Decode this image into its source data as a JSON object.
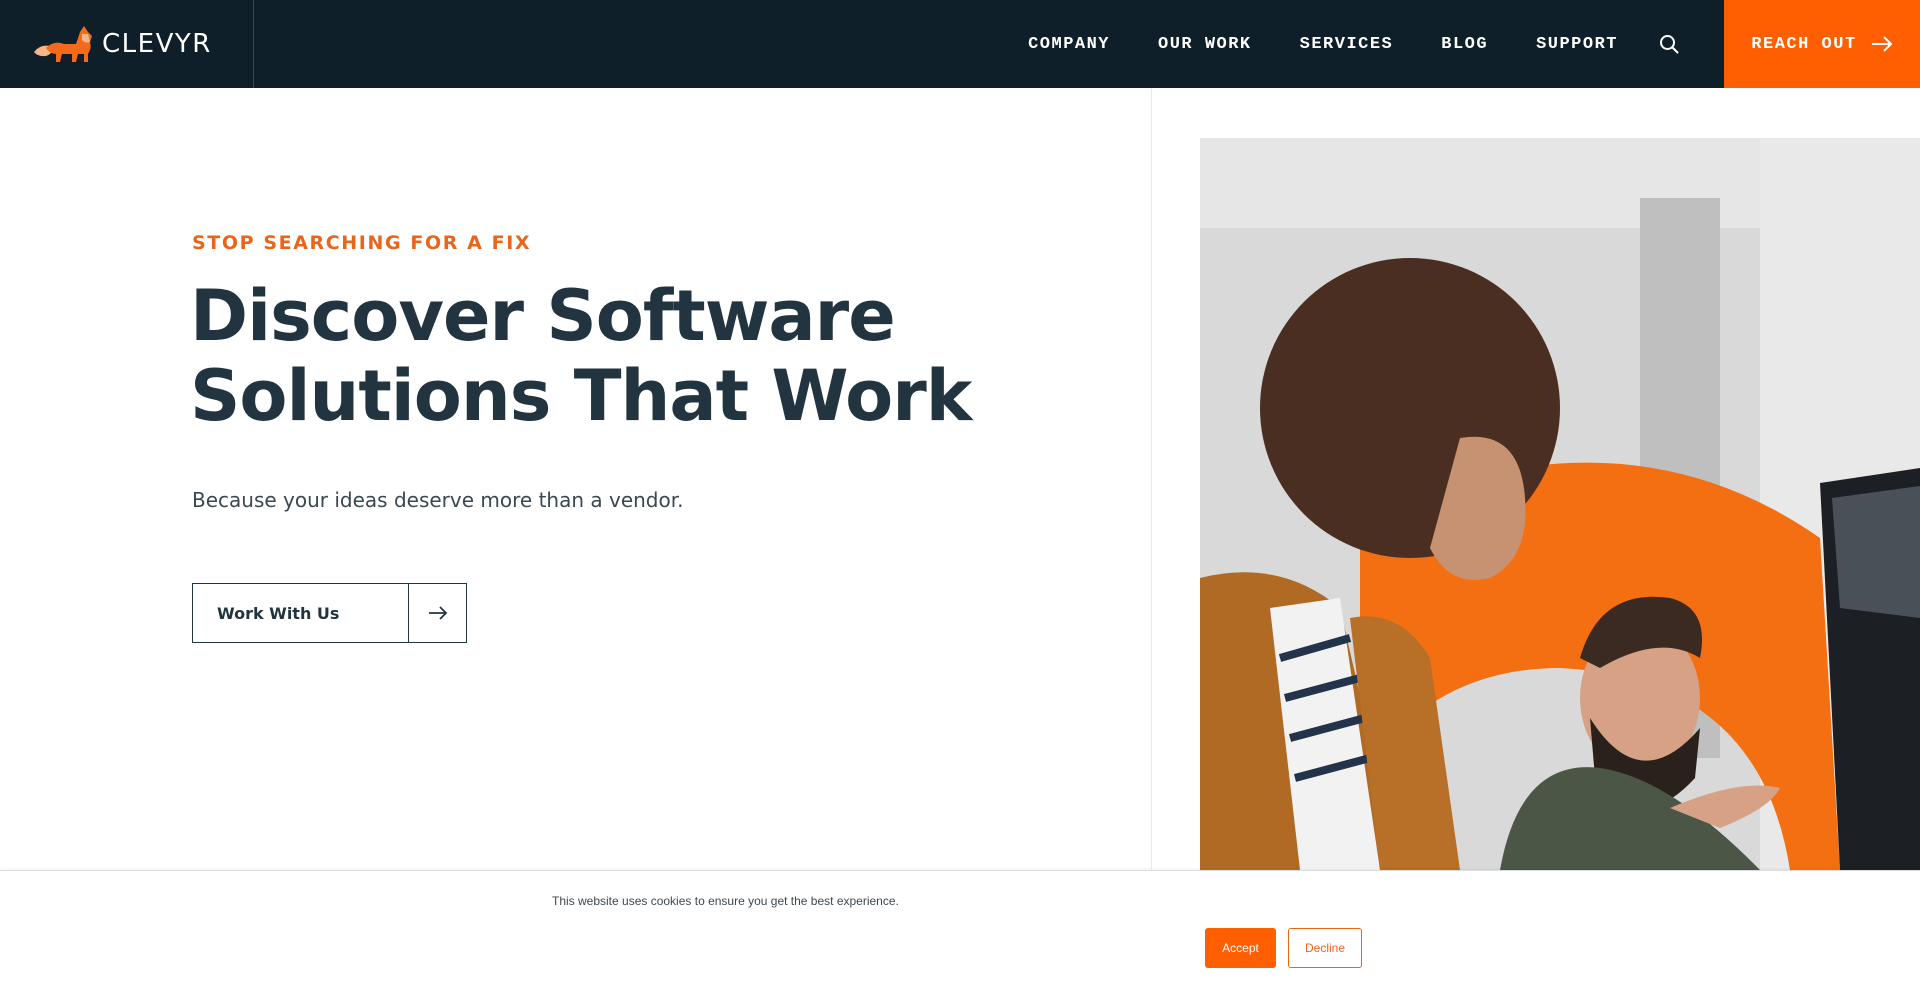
{
  "brand": {
    "name": "CLEVYR",
    "accent_color": "#ff5f00",
    "nav_bg_color": "#0e1f29",
    "heading_color": "#22343f"
  },
  "nav": {
    "items": [
      {
        "label": "COMPANY"
      },
      {
        "label": "OUR WORK"
      },
      {
        "label": "SERVICES"
      },
      {
        "label": "BLOG"
      },
      {
        "label": "SUPPORT"
      }
    ],
    "search_icon": "search-icon",
    "cta_label": "REACH OUT",
    "cta_icon": "arrow-right-icon"
  },
  "hero": {
    "eyebrow": "STOP SEARCHING FOR A FIX",
    "headline_line1": "Discover Software",
    "headline_line2": "Solutions That Work",
    "subtext": "Because your ideas deserve more than a vendor.",
    "cta_label": "Work With Us",
    "cta_icon": "arrow-right-icon",
    "image_description": "Smiling woman with curly hair and bearded man looking at a computer monitor with an orange arc behind them"
  },
  "cookie_banner": {
    "message": "This website uses cookies to ensure you get the best experience.",
    "accept_label": "Accept",
    "decline_label": "Decline"
  }
}
